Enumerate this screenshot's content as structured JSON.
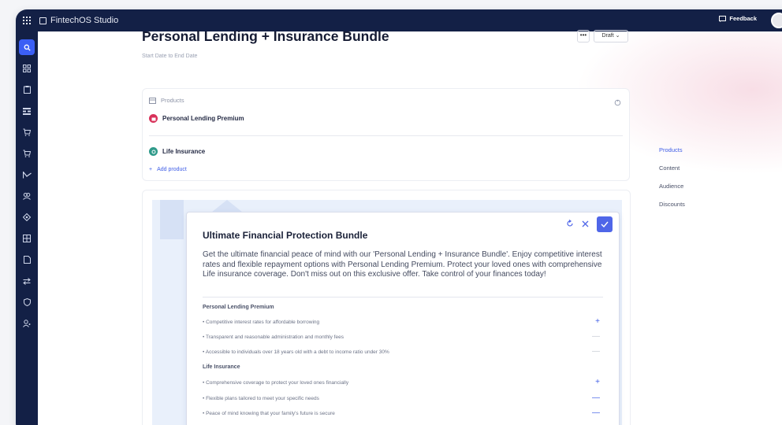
{
  "app": {
    "name": "FintechOS Studio"
  },
  "topbar": {
    "feedback_label": "Feedback"
  },
  "page": {
    "title": "Personal Lending + Insurance Bundle",
    "date_range": "Start Date to End Date",
    "more_label": "•••",
    "status_label": "Draft"
  },
  "products": {
    "header": "Products",
    "items": [
      {
        "name": "Personal Lending Premium",
        "color": "#d8325a"
      },
      {
        "name": "Life Insurance",
        "color": "#2f9a8a"
      }
    ],
    "add_label": "Add product"
  },
  "right_nav": [
    "Products",
    "Content",
    "Audience",
    "Discounts"
  ],
  "editor": {
    "title": "Ultimate Financial Protection Bundle",
    "body": "Get the ultimate financial peace of mind with our 'Personal Lending + Insurance Bundle'. Enjoy competitive interest rates and flexible repayment options with Personal Lending Premium. Protect your loved ones with comprehensive Life insurance coverage. Don't miss out on this exclusive offer. Take control of your finances today!",
    "sections": [
      {
        "label": "Personal Lending Premium",
        "bullets": [
          {
            "text": "Competitive interest rates for affordable borrowing",
            "sign": "+"
          },
          {
            "text": "Transparent and reasonable administration and monthly fees",
            "sign": "—"
          },
          {
            "text": "Accessible to individuals over 18 years old with a debt to income ratio under 30%",
            "sign": "—"
          }
        ]
      },
      {
        "label": "Life Insurance",
        "bullets": [
          {
            "text": "Comprehensive coverage to protect your loved ones financially",
            "sign": "+"
          },
          {
            "text": "Flexible plans tailored to meet your specific needs",
            "sign": "—"
          },
          {
            "text": "Peace of mind knowing that your family's future is secure",
            "sign": "—"
          }
        ]
      }
    ]
  },
  "colors": {
    "sidebar": "#132046",
    "accent": "#3d5ce6"
  }
}
